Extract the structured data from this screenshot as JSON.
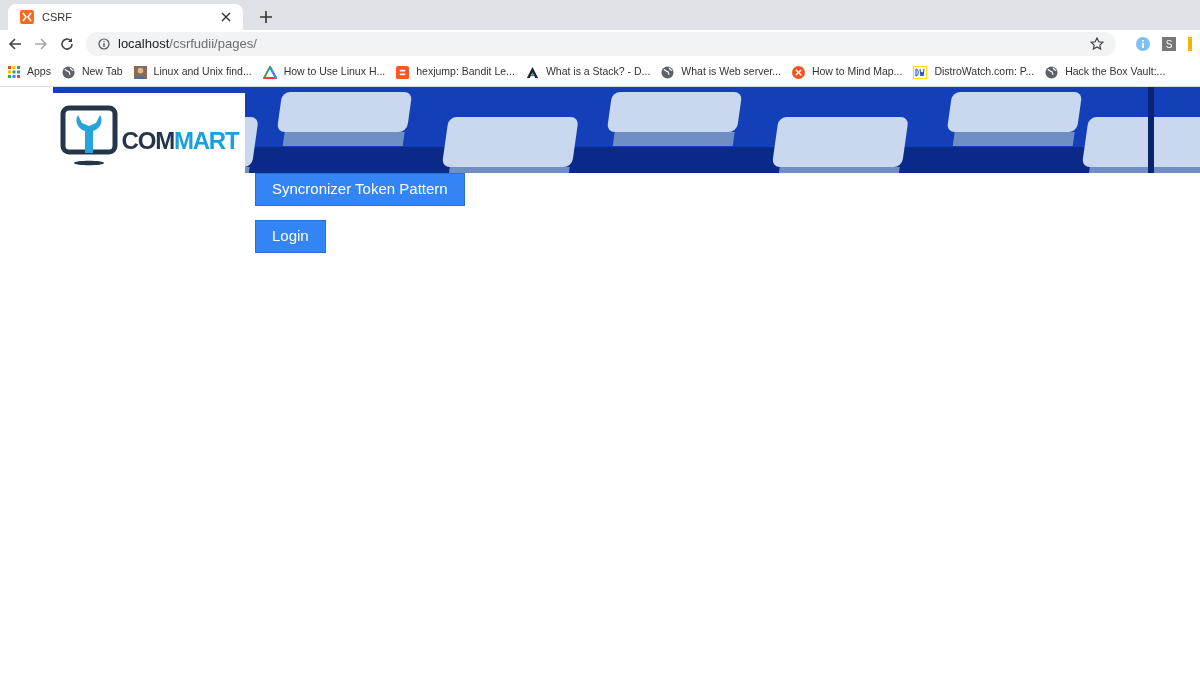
{
  "browser": {
    "tabs": [
      {
        "title": "CSRF",
        "selected": true
      }
    ],
    "address": {
      "host": "localhost",
      "path": "/csrfudii/pages/"
    },
    "bookmarks": [
      {
        "kind": "grid",
        "label": "Apps"
      },
      {
        "kind": "globe",
        "label": "New Tab"
      },
      {
        "kind": "avatar",
        "label": "Linux and Unix find..."
      },
      {
        "kind": "triangle",
        "label": "How to Use Linux H..."
      },
      {
        "kind": "blog",
        "label": "hexjump: Bandit Le..."
      },
      {
        "kind": "peak",
        "label": "What is a Stack? - D..."
      },
      {
        "kind": "globe",
        "label": "What is Web server..."
      },
      {
        "kind": "cross",
        "label": "How to Mind Map..."
      },
      {
        "kind": "dw",
        "label": "DistroWatch.com: P..."
      },
      {
        "kind": "globe",
        "label": "Hack the Box Vault:..."
      }
    ],
    "profile_letter": "S"
  },
  "page": {
    "logo": {
      "dark_part": "COM",
      "accent_part": "MART"
    },
    "buttons": [
      "Syncronizer Token Pattern",
      "Login"
    ]
  }
}
